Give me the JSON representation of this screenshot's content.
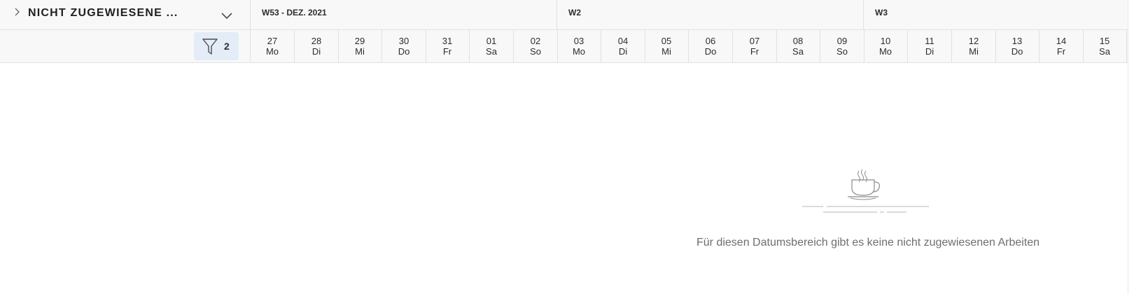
{
  "group": {
    "title": "NICHT ZUGEWIESENE ...",
    "filter_count": "2"
  },
  "weeks": [
    {
      "label": "W53 - DEZ. 2021"
    },
    {
      "label": "W2"
    },
    {
      "label": "W3"
    }
  ],
  "days": [
    {
      "num": "27",
      "name": "Mo"
    },
    {
      "num": "28",
      "name": "Di"
    },
    {
      "num": "29",
      "name": "Mi"
    },
    {
      "num": "30",
      "name": "Do"
    },
    {
      "num": "31",
      "name": "Fr"
    },
    {
      "num": "01",
      "name": "Sa"
    },
    {
      "num": "02",
      "name": "So"
    },
    {
      "num": "03",
      "name": "Mo"
    },
    {
      "num": "04",
      "name": "Di"
    },
    {
      "num": "05",
      "name": "Mi"
    },
    {
      "num": "06",
      "name": "Do"
    },
    {
      "num": "07",
      "name": "Fr"
    },
    {
      "num": "08",
      "name": "Sa"
    },
    {
      "num": "09",
      "name": "So"
    },
    {
      "num": "10",
      "name": "Mo"
    },
    {
      "num": "11",
      "name": "Di"
    },
    {
      "num": "12",
      "name": "Mi"
    },
    {
      "num": "13",
      "name": "Do"
    },
    {
      "num": "14",
      "name": "Fr"
    },
    {
      "num": "15",
      "name": "Sa"
    }
  ],
  "empty_state": {
    "message": "Für diesen Datumsbereich gibt es keine nicht zugewiesenen Arbeiten",
    "illustration": "coffee-cup-icon"
  },
  "icons": {
    "expand": "chevron-right-icon",
    "collapse": "chevron-down-icon",
    "filter": "filter-funnel-icon"
  },
  "colors": {
    "header_bg": "#f8f8f8",
    "filter_button_bg": "#e3ecf7",
    "border": "#e1e1e1",
    "muted_text": "#6e6e6e"
  }
}
